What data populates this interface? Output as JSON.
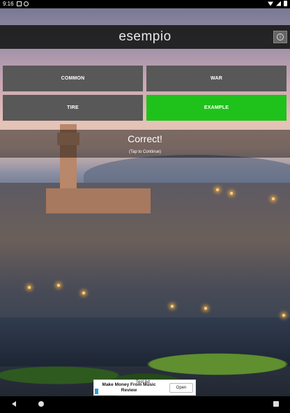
{
  "status_bar": {
    "time": "9:16",
    "icons": [
      "notification-icon",
      "notification-icon",
      "wifi-icon",
      "signal-icon",
      "battery-icon"
    ]
  },
  "header": {
    "title": "esempio",
    "info_icon": "info-icon"
  },
  "answers": [
    {
      "label": "COMMON",
      "state": "default"
    },
    {
      "label": "WAR",
      "state": "default"
    },
    {
      "label": "TIRE",
      "state": "default"
    },
    {
      "label": "EXAMPLE",
      "state": "correct"
    }
  ],
  "result": {
    "message": "Correct!",
    "hint": "(Tap to Continue)"
  },
  "ad": {
    "test_label": "Test Ad",
    "text": "Make Money From Music Review",
    "button_label": "Open"
  },
  "colors": {
    "correct": "#1fc21b",
    "default_button": "#585858",
    "header_bg": "#1a1a1a"
  },
  "navbar": {
    "icons": [
      "back-icon",
      "home-icon",
      "recents-icon"
    ]
  }
}
